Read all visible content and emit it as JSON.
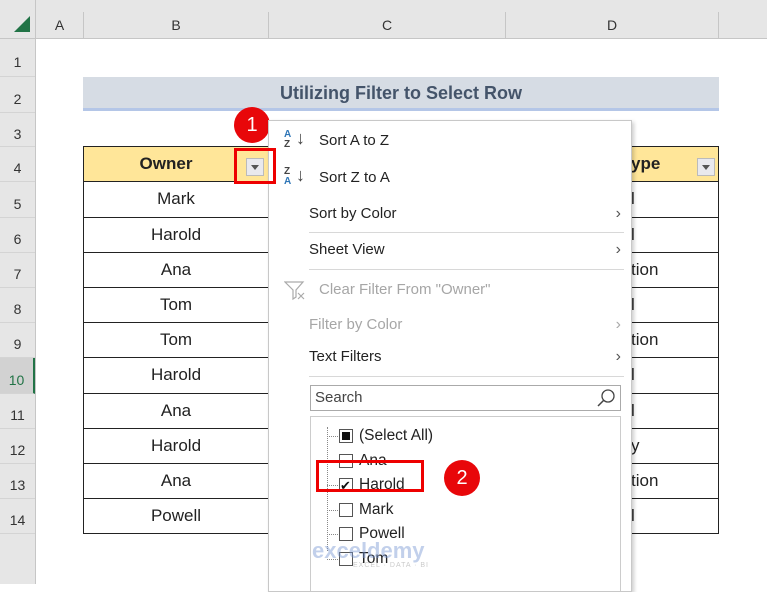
{
  "columns": [
    "A",
    "B",
    "C",
    "D"
  ],
  "rows": [
    "1",
    "2",
    "3",
    "4",
    "5",
    "6",
    "7",
    "8",
    "9",
    "10",
    "11",
    "12",
    "13",
    "14"
  ],
  "selected_row": "10",
  "title": "Utilizing Filter to Select Row",
  "table": {
    "header_b": "Owner",
    "header_d_partial": "ype",
    "owners": [
      "Mark",
      "Harold",
      "Ana",
      "Tom",
      "Tom",
      "Harold",
      "Ana",
      "Harold",
      "Ana",
      "Powell"
    ],
    "col_d_partial": [
      "l",
      "l",
      "tion",
      "l",
      "tion",
      "l",
      "l",
      "y",
      "tion",
      "l"
    ]
  },
  "badges": {
    "one": "1",
    "two": "2"
  },
  "menu": {
    "sort_az": "Sort A to Z",
    "sort_za": "Sort Z to A",
    "sort_color": "Sort by Color",
    "sheet_view": "Sheet View",
    "clear_filter": "Clear Filter From \"Owner\"",
    "filter_color": "Filter by Color",
    "text_filters": "Text Filters",
    "search_placeholder": "Search",
    "items": [
      {
        "label": "(Select All)",
        "state": "partial"
      },
      {
        "label": "Ana",
        "state": "unchecked"
      },
      {
        "label": "Harold",
        "state": "checked"
      },
      {
        "label": "Mark",
        "state": "unchecked"
      },
      {
        "label": "Powell",
        "state": "unchecked"
      },
      {
        "label": "Tom",
        "state": "unchecked"
      }
    ]
  },
  "watermark": {
    "brand": "exceldemy",
    "tagline": "EXCEL · DATA · BI"
  },
  "colors": {
    "accent": "#217346",
    "header_fill": "#ffe699",
    "title_fill": "#d6dce4",
    "badge": "#e8070a"
  }
}
